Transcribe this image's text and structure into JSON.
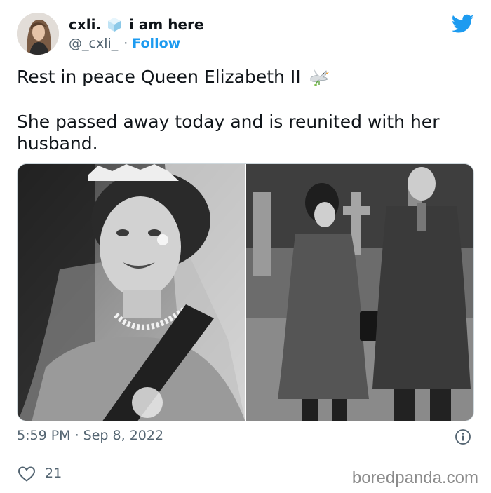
{
  "user": {
    "display_name": "cxli.",
    "display_name_suffix": "i am here",
    "handle": "@_cxli_",
    "separator": "·",
    "follow_label": "Follow"
  },
  "tweet": {
    "line1": "Rest in peace Queen Elizabeth II",
    "line2": "She passed away today and is reunited with her husband.",
    "timestamp": "5:59 PM · Sep 8, 2022",
    "likes": "21"
  },
  "media": {
    "left_image": "black-and-white photo of Queen Elizabeth II wearing a tiara and necklace",
    "right_image": "black-and-white photo of a couple walking in coats"
  },
  "icons": {
    "ice": "ice-cube-icon",
    "dove": "dove-icon",
    "logo": "twitter-bird-icon",
    "info": "info-icon",
    "like": "heart-icon"
  },
  "colors": {
    "accent": "#1d9bf0",
    "text": "#0f1419",
    "muted": "#536471",
    "border": "#cfd9de"
  },
  "watermark": "boredpanda.com"
}
